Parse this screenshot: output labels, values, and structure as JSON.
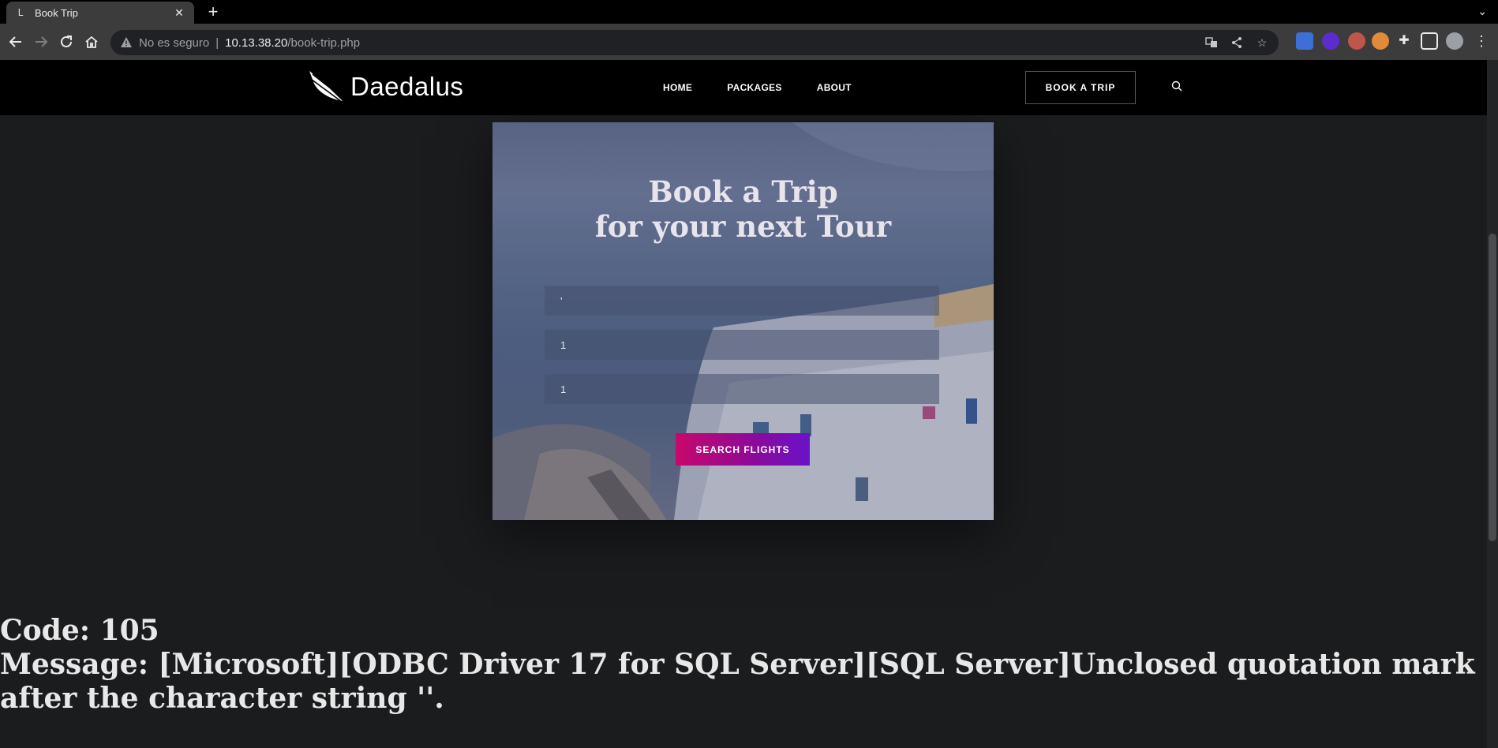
{
  "browser": {
    "tab_title": "Book Trip",
    "tab_favicon": "L",
    "insecure_label": "No es seguro",
    "url_host": "10.13.38.20",
    "url_path": "/book-trip.php"
  },
  "site": {
    "logo_text": "Daedalus",
    "nav": [
      "HOME",
      "PACKAGES",
      "ABOUT"
    ],
    "book_button": "BOOK A TRIP"
  },
  "hero": {
    "title_line1": "Book a Trip",
    "title_line2": "for your next Tour",
    "fields": [
      "'",
      "1",
      "1"
    ],
    "submit": "SEARCH FLIGHTS"
  },
  "error": {
    "code_line": "Code: 105",
    "message_line": "Message: [Microsoft][ODBC Driver 17 for SQL Server][SQL Server]Unclosed quotation mark after the character string ''."
  },
  "colors": {
    "accent_start": "#c8086b",
    "accent_end": "#6a12c8",
    "page_bg": "#1b1c1e"
  }
}
